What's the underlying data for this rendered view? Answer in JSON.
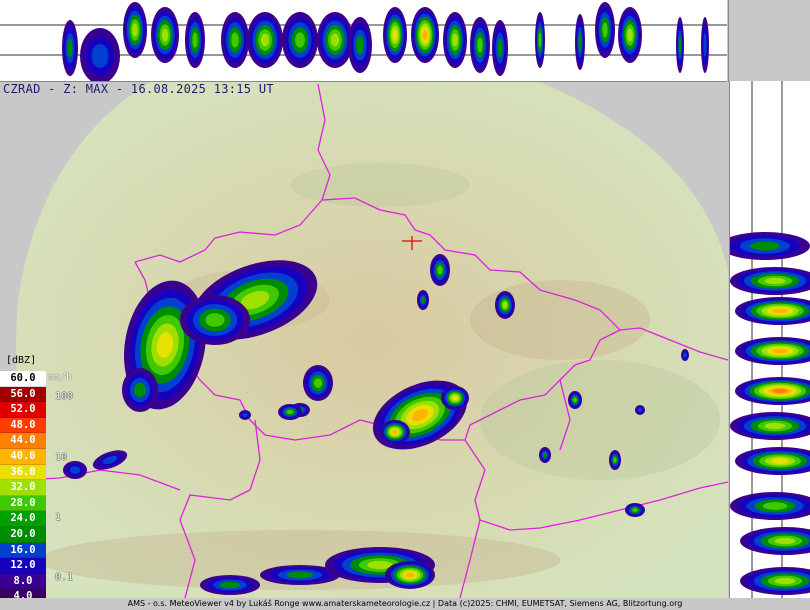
{
  "title": "CZRAD - Z: MAX - 16.08.2025 13:15 UT",
  "legend": {
    "unit": "[dBZ]",
    "rain_unit": "mm/h",
    "rows": [
      {
        "label": "60.0",
        "color": "#ffffff",
        "text": "#000000"
      },
      {
        "label": "56.0",
        "color": "#a00000",
        "text": "#ffffff"
      },
      {
        "label": "52.0",
        "color": "#e00000",
        "text": "#ffffff"
      },
      {
        "label": "48.0",
        "color": "#ff3c00",
        "text": "#ffffff"
      },
      {
        "label": "44.0",
        "color": "#ff8000",
        "text": "#ffffff"
      },
      {
        "label": "40.0",
        "color": "#ffb400",
        "text": "#ffffff"
      },
      {
        "label": "36.0",
        "color": "#e8e000",
        "text": "#ffffff"
      },
      {
        "label": "32.0",
        "color": "#a0e000",
        "text": "#ffffff"
      },
      {
        "label": "28.0",
        "color": "#40c800",
        "text": "#ffffff"
      },
      {
        "label": "24.0",
        "color": "#00a000",
        "text": "#ffffff"
      },
      {
        "label": "20.0",
        "color": "#008c00",
        "text": "#ffffff"
      },
      {
        "label": "16.0",
        "color": "#0040d0",
        "text": "#ffffff"
      },
      {
        "label": "12.0",
        "color": "#1800c0",
        "text": "#ffffff"
      },
      {
        "label": "8.0",
        "color": "#3a0090",
        "text": "#ffffff"
      },
      {
        "label": "4.0",
        "color": "#380060",
        "text": "#ffffff"
      }
    ],
    "rain_rates": [
      "100",
      "10",
      "1",
      "0.1"
    ]
  },
  "footer": "AMS - o.s. MeteoViewer v4 by Lukáš Ronge www.amaterskameteorologie.cz | Data (c)2025: CHMI, EUMETSAT, Siemens AG, Blitzortung.org"
}
